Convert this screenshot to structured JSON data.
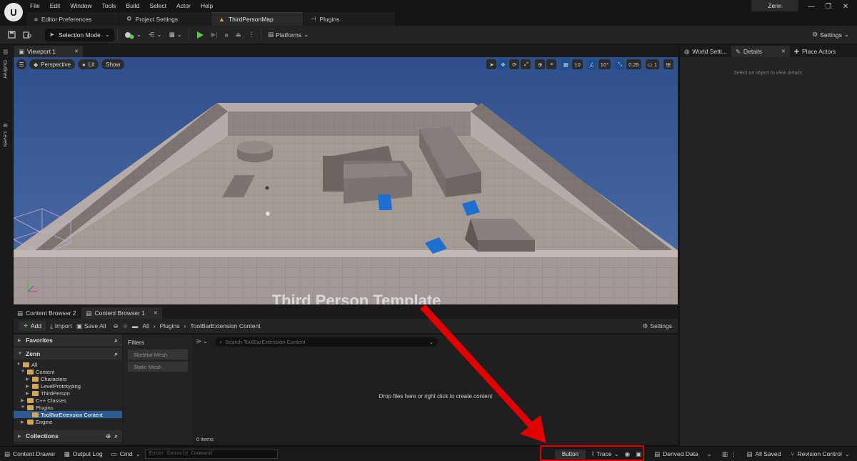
{
  "menu": [
    "File",
    "Edit",
    "Window",
    "Tools",
    "Build",
    "Select",
    "Actor",
    "Help"
  ],
  "document_tabs": [
    {
      "label": "Editor Preferences",
      "icon": "sliders-icon"
    },
    {
      "label": "Project Settings",
      "icon": "gear-icon"
    },
    {
      "label": "ThirdPersonMap",
      "icon": "level-icon",
      "active": true
    },
    {
      "label": "Plugins",
      "icon": "plug-icon"
    }
  ],
  "user": "Zenn",
  "toolbar": {
    "selection_mode": "Selection Mode",
    "platforms": "Platforms",
    "settings": "Settings"
  },
  "left_strip": {
    "outliner": "Outliner",
    "levels": "Levels"
  },
  "viewport": {
    "tab": "Viewport 1",
    "perspective": "Perspective",
    "lit": "Lit",
    "show": "Show",
    "grid_snap": "10",
    "rotation_snap": "10°",
    "scale_snap": "0.25",
    "camera_speed": "1",
    "overlay_text": "Third Person Template"
  },
  "right_panel": {
    "tabs": [
      "World Setti...",
      "Details",
      "Place Actors"
    ],
    "details_message": "Select an object to view details."
  },
  "content_browser": {
    "tabs": [
      "Content Browser 2",
      "Content Browser 1"
    ],
    "add": "Add",
    "import": "Import",
    "save_all": "Save All",
    "breadcrumb": [
      "All",
      "Plugins",
      "ToolBarExtension Content"
    ],
    "settings": "Settings",
    "favorites": "Favorites",
    "project": "Zenn",
    "tree": [
      {
        "label": "All",
        "level": 0
      },
      {
        "label": "Content",
        "level": 1
      },
      {
        "label": "Characters",
        "level": 2
      },
      {
        "label": "LevelPrototyping",
        "level": 2
      },
      {
        "label": "ThirdPerson",
        "level": 2
      },
      {
        "label": "C++ Classes",
        "level": 1
      },
      {
        "label": "Plugins",
        "level": 1
      },
      {
        "label": "ToolBarExtension Content",
        "level": 2,
        "selected": true
      },
      {
        "label": "Engine",
        "level": 1
      }
    ],
    "collections": "Collections",
    "filters_title": "Filters",
    "filters": [
      "Skeletal Mesh",
      "Static Mesh"
    ],
    "search_placeholder": "Search ToolBarExtension Content",
    "drop_message": "Drop files here or right click to create content",
    "item_count": "0 items"
  },
  "statusbar": {
    "content_drawer": "Content Drawer",
    "output_log": "Output Log",
    "cmd": "Cmd",
    "console_placeholder": "Enter Console Command",
    "button": "Button",
    "trace": "Trace",
    "derived_data": "Derived Data",
    "all_saved": "All Saved",
    "revision_control": "Revision Control"
  },
  "colors": {
    "highlight_box": "#e00000",
    "arrow": "#e00000",
    "viewport_sky": "#3a5f9f",
    "selection": "#2b5a8e"
  }
}
